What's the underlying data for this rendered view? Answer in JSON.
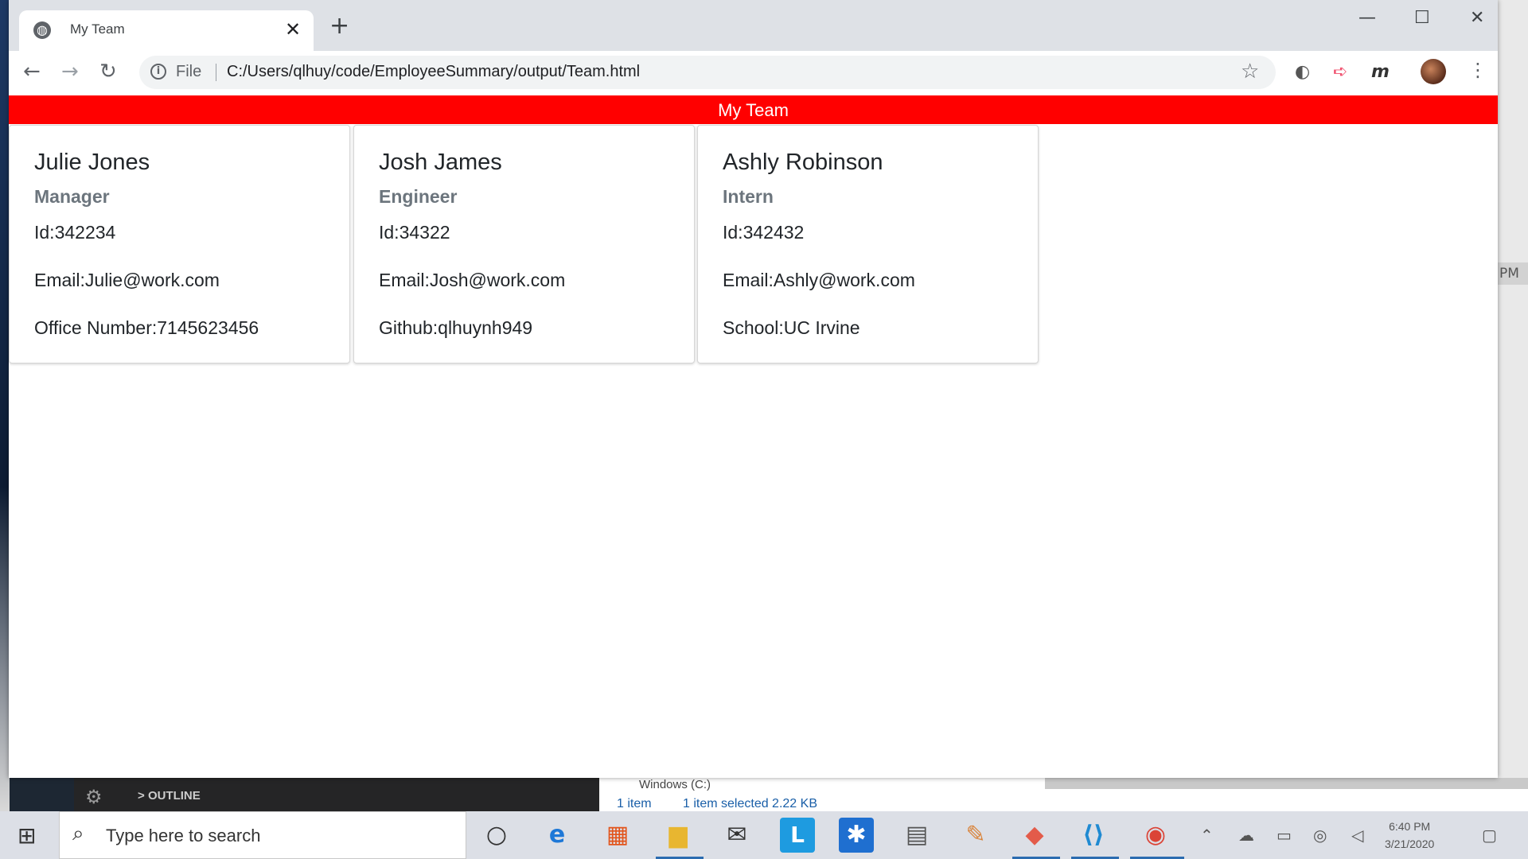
{
  "browser": {
    "tab_title": "My Team",
    "file_label": "File",
    "url": "C:/Users/qlhuy/code/EmployeeSummary/output/Team.html"
  },
  "page": {
    "header": "My Team",
    "cards": [
      {
        "name": "Julie Jones",
        "role": "Manager",
        "id": "Id:342234",
        "email": "Email:Julie@work.com",
        "extra": "Office Number:7145623456"
      },
      {
        "name": "Josh James",
        "role": "Engineer",
        "id": "Id:34322",
        "email": "Email:Josh@work.com",
        "extra": "Github:qlhuynh949"
      },
      {
        "name": "Ashly Robinson",
        "role": "Intern",
        "id": "Id:342432",
        "email": "Email:Ashly@work.com",
        "extra": "School:UC Irvine"
      }
    ]
  },
  "background": {
    "right_strip_text": "PM",
    "vscode_outline": "OUTLINE",
    "explorer_drive": "Windows (C:)",
    "explorer_items": "1 item",
    "explorer_selected": "1 item selected  2.22 KB"
  },
  "taskbar": {
    "search_placeholder": "Type here to search",
    "time": "6:40 PM",
    "date": "3/21/2020"
  },
  "colors": {
    "header_red": "#ff0000",
    "role_grey": "#6c757d"
  }
}
